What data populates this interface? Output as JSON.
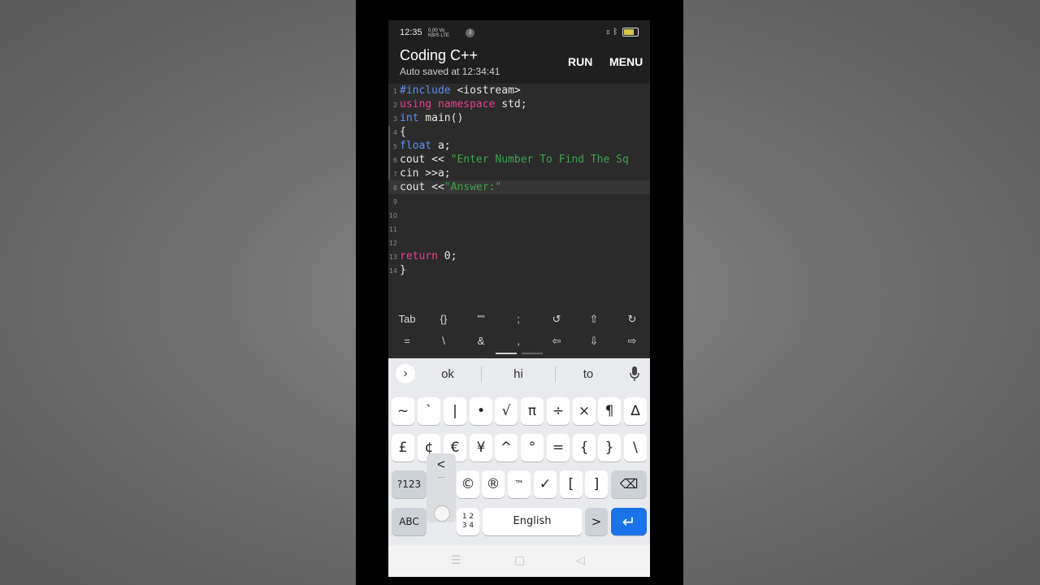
{
  "status": {
    "time": "12:35",
    "net_line1": "0.00 Vo",
    "net_line2": "KB/S LTE",
    "notif_count": "3",
    "battery": "84"
  },
  "app": {
    "title": "Coding C++",
    "subtitle": "Auto saved at 12:34:41",
    "run_label": "RUN",
    "menu_label": "MENU"
  },
  "editor": {
    "line_numbers": [
      "1",
      "2",
      "3",
      "4",
      "5",
      "6",
      "7",
      "8",
      "9",
      "10",
      "11",
      "12",
      "13",
      "14"
    ],
    "lines": [
      {
        "t1": "#include",
        "t2": " <iostream>"
      },
      {
        "t1": "using",
        "t2": " ",
        "t3": "namespace",
        "t4": " std;"
      },
      {
        "t1": "int",
        "t2": " main()"
      },
      {
        "t1": "{"
      },
      {
        "t1": "float",
        "t2": " a;"
      },
      {
        "t1": "cout << ",
        "t2": "\"Enter Number To Find The Sq"
      },
      {
        "t1": "cin >>a;"
      },
      {
        "t1": "cout <<",
        "t2": "\"Answer:\""
      },
      {},
      {},
      {},
      {},
      {
        "t1": "return",
        "t2": " 0;"
      },
      {
        "t1": "}"
      }
    ]
  },
  "symbols": {
    "row1": [
      "Tab",
      "{}",
      "\"\"",
      ";",
      "↺",
      "⇧",
      "↻"
    ],
    "row2": [
      "=",
      "\\",
      "&",
      ",",
      "⇦",
      "⇩",
      "⇨"
    ]
  },
  "keyboard": {
    "suggestions": [
      "ok",
      "hi",
      "to"
    ],
    "row1": [
      "~",
      "`",
      "|",
      "•",
      "√",
      "π",
      "÷",
      "×",
      "¶",
      "∆"
    ],
    "row2": [
      "£",
      "¢",
      "€",
      "¥",
      "^",
      "°",
      "=",
      "{",
      "}",
      "\\"
    ],
    "row3_left": "?123",
    "row3": [
      "©",
      "®",
      "™",
      "✓",
      "[",
      "]"
    ],
    "popup": "<",
    "popup_more": "…",
    "abc": "ABC",
    "num_toggle": "1 2\n3 4",
    "space": "English",
    "gt": ">",
    "enter": "↵",
    "backspace": "⌫"
  },
  "colors": {
    "keyword_blue": "#5b8ff0",
    "keyword_pink": "#e8408f",
    "string_green": "#3fa34d",
    "enter_blue": "#1a73e8"
  }
}
